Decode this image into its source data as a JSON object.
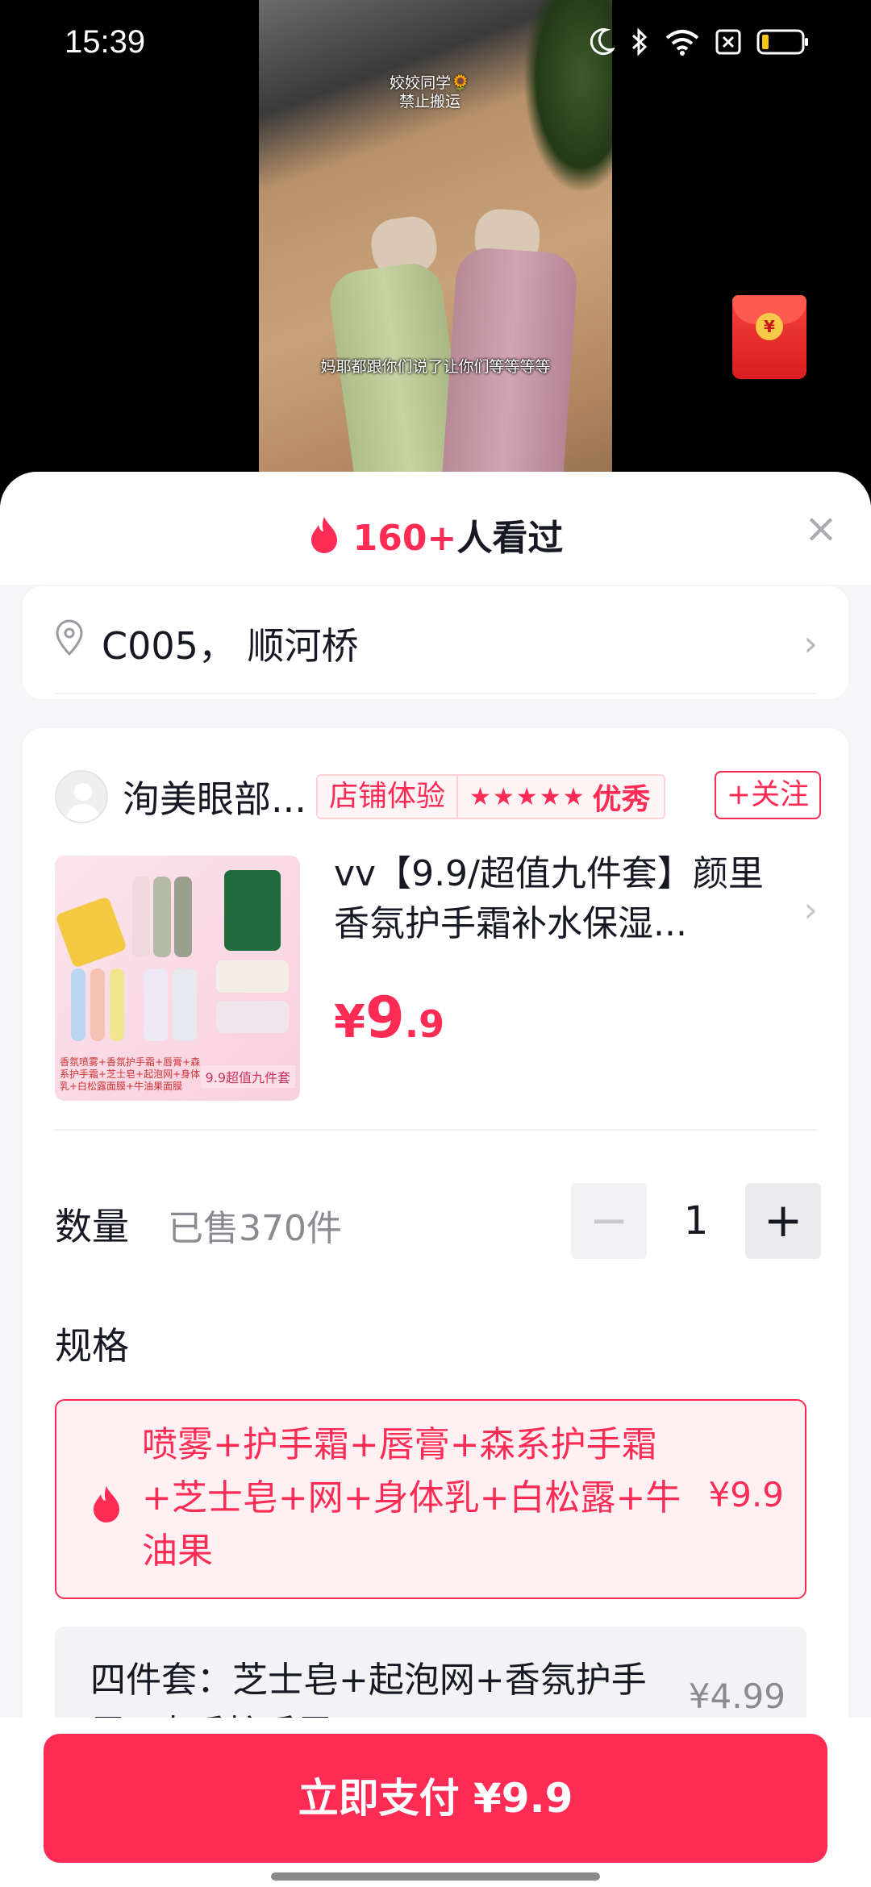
{
  "status_bar": {
    "time": "15:39"
  },
  "video": {
    "watermark_line1": "姣姣同学🌻",
    "watermark_line2": "禁止搬运",
    "subtitle": "妈耶都跟你们说了让你们等等等等"
  },
  "sheet": {
    "views_count": "160+",
    "views_suffix": "人看过",
    "close": "×"
  },
  "address": {
    "text": "C005， 顺河桥"
  },
  "shop": {
    "name": "洵美眼部...",
    "badge_label": "店铺体验",
    "stars": "★★★★★",
    "grade": "优秀",
    "follow": "+关注"
  },
  "product": {
    "title": "vv【9.9/超值九件套】颜里香氛护手霜补水保湿...",
    "price_currency": "¥",
    "price_int": "9",
    "price_dec": ".9",
    "thumb_caption": "香氛喷雾+香氛护手霜+唇膏+森系护手霜+芝士皂+起泡网+身体乳+白松露面膜+牛油果面膜",
    "thumb_tag": "9.9超值九件套"
  },
  "quantity": {
    "label": "数量",
    "sold": "已售370件",
    "minus": "−",
    "value": "1",
    "plus": "+"
  },
  "spec": {
    "label": "规格",
    "options": [
      {
        "text": "喷雾+护手霜+唇膏+森系护手霜+芝士皂+网+身体乳+白松露+牛油果",
        "price": "¥9.9",
        "selected": true
      },
      {
        "text": "四件套：芝士皂+起泡网+香氛护手霜+森系护手霜",
        "price": "¥4.99",
        "selected": false
      }
    ]
  },
  "pay_button": "立即支付 ¥9.9",
  "colors": {
    "accent": "#fe2c55",
    "muted": "#8a8b91"
  }
}
